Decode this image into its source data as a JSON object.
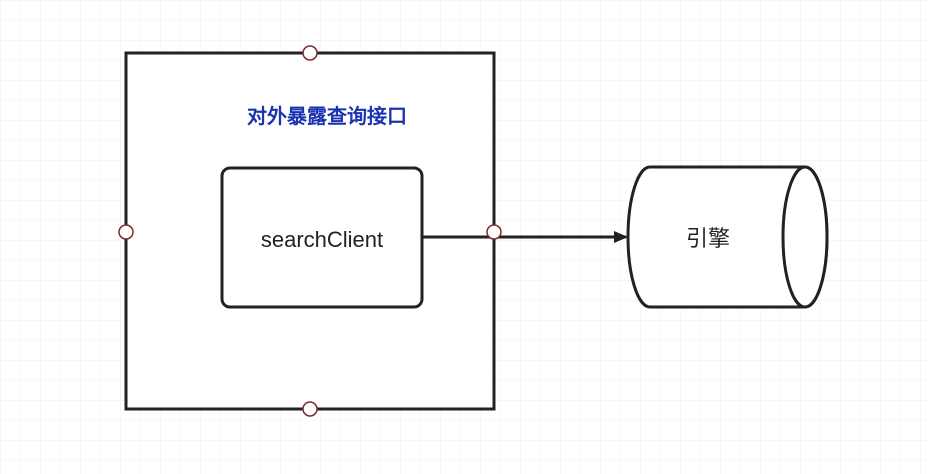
{
  "diagram": {
    "container": {
      "title": "对外暴露查询接口",
      "title_color": "#1a33b3"
    },
    "inner_box": {
      "label": "searchClient"
    },
    "cylinder": {
      "label": "引擎"
    },
    "colors": {
      "grid_line": "#e6e6e6",
      "stroke": "#222222",
      "connection_point_stroke": "#7a2a2a",
      "connection_point_fill": "#ffffff",
      "background": "#ffffff"
    }
  }
}
